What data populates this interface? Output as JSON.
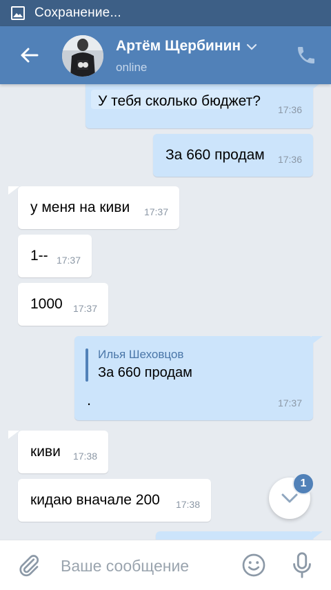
{
  "statusbar": {
    "text": "Сохранение..."
  },
  "header": {
    "name": "Артём Щербинин",
    "status": "online"
  },
  "messages": [
    {
      "dir": "out",
      "text": "У тебя сколько бюджет?",
      "time": "17:36"
    },
    {
      "dir": "out",
      "text": "За 660 продам",
      "time": "17:36"
    },
    {
      "dir": "in",
      "text": "у меня на киви",
      "time": "17:37"
    },
    {
      "dir": "in",
      "text": "1--",
      "time": "17:37"
    },
    {
      "dir": "in",
      "text": "1000",
      "time": "17:37"
    },
    {
      "dir": "out",
      "reply_author": "Илья Шеховцов",
      "reply_text": "За 660 продам",
      "text": ".",
      "time": "17:37"
    },
    {
      "dir": "in",
      "text": "киви",
      "time": "17:38"
    },
    {
      "dir": "in",
      "text": "кидаю вначале 200",
      "time": "17:38"
    }
  ],
  "scroll_button": {
    "unread_count": "1"
  },
  "input": {
    "placeholder": "Ваше сообщение"
  },
  "colors": {
    "header": "#5181b8",
    "statusbar": "#3d5f86",
    "outgoing": "#cce4fb",
    "incoming": "#ffffff",
    "background": "#e7ebf0"
  },
  "icons": [
    "image-icon",
    "back-arrow-icon",
    "chevron-down-icon",
    "phone-icon",
    "chevron-down-icon",
    "paperclip-icon",
    "emoji-icon",
    "microphone-icon"
  ]
}
